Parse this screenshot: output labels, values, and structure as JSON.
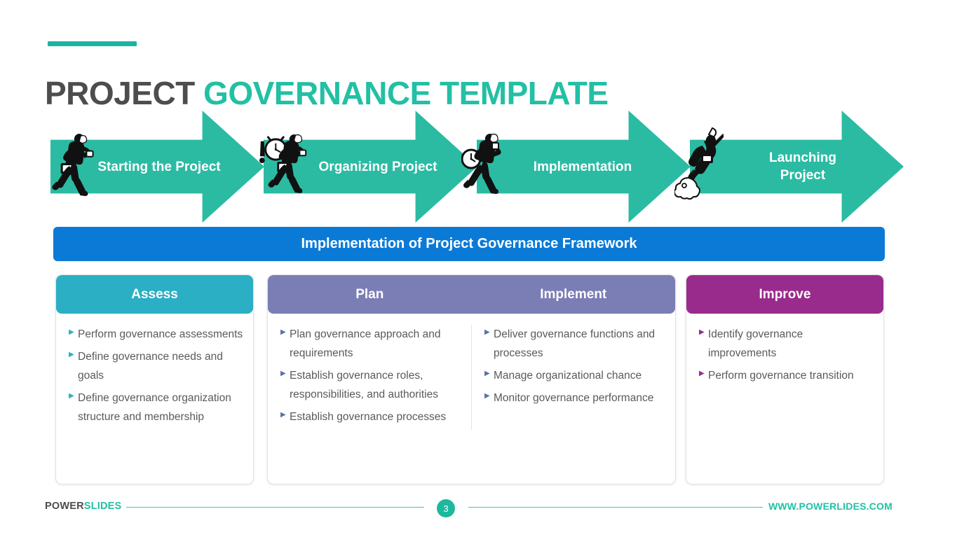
{
  "title": {
    "part_dark": "PROJECT",
    "part_green": " GOVERNANCE TEMPLATE"
  },
  "colors": {
    "accent_green": "#22c0a4",
    "arrow_green": "#2bbba3",
    "banner_blue": "#0b7ad6",
    "assess_teal": "#2bafc4",
    "plan_purple": "#7b7db5",
    "improve_magenta": "#992b8c",
    "body_text": "#5a5a5a"
  },
  "process_arrows": [
    {
      "label": "Starting the Project",
      "icon": "running-businessman-icon"
    },
    {
      "label": "Organizing Project",
      "icon": "running-businessman-with-clock-icon"
    },
    {
      "label": "Implementation",
      "icon": "running-businessman-with-clock-icon"
    },
    {
      "label": "Launching Project",
      "icon": "businessman-rocket-launch-icon"
    }
  ],
  "banner": {
    "text": "Implementation of Project Governance Framework"
  },
  "cards": [
    {
      "id": "assess",
      "headers": [
        "Assess"
      ],
      "header_color": "#2bafc4",
      "bullet_color": "#2bafc4",
      "columns": [
        {
          "bullets": [
            "Perform governance assessments",
            "Define governance needs and goals",
            "Define governance organization structure and membership"
          ]
        }
      ]
    },
    {
      "id": "plan-implement",
      "headers": [
        "Plan",
        "Implement"
      ],
      "header_color": "#7b7db5",
      "bullet_color": "#5b72a8",
      "columns": [
        {
          "bullets": [
            "Plan governance approach and requirements",
            "Establish governance roles, responsibilities, and authorities",
            "Establish governance processes"
          ]
        },
        {
          "bullets": [
            "Deliver governance functions and processes",
            "Manage organizational chance",
            "Monitor governance performance"
          ]
        }
      ]
    },
    {
      "id": "improve",
      "headers": [
        "Improve"
      ],
      "header_color": "#992b8c",
      "bullet_color": "#992b8c",
      "columns": [
        {
          "bullets": [
            "Identify governance improvements",
            "Perform governance transition"
          ]
        }
      ]
    }
  ],
  "footer": {
    "logo_dark": "POWER",
    "logo_green": "SLIDES",
    "page_number": "3",
    "url": "WWW.POWERLIDES.COM"
  }
}
